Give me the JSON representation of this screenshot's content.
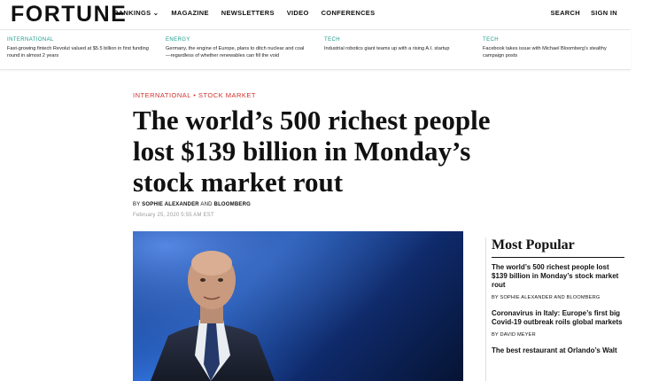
{
  "nav": {
    "logo": "FORTUNE",
    "items": [
      "RANKINGS ⌄",
      "MAGAZINE",
      "NEWSLETTERS",
      "VIDEO",
      "CONFERENCES"
    ],
    "search": "SEARCH",
    "signin": "SIGN IN"
  },
  "ticker": [
    {
      "category": "INTERNATIONAL",
      "text": "Fast-growing fintech Revolut valued at $5.5 billion in first funding round in almost 2 years"
    },
    {
      "category": "ENERGY",
      "text": "Germany, the engine of Europe, plans to ditch nuclear and coal—regardless of whether renewables can fill the void"
    },
    {
      "category": "TECH",
      "text": "Industrial robotics giant teams up with a rising A.I. startup"
    },
    {
      "category": "TECH",
      "text": "Facebook takes issue with Michael Bloomberg's stealthy campaign posts"
    }
  ],
  "article": {
    "kicker": "INTERNATIONAL • STOCK MARKET",
    "headline": "The world’s 500 richest people lost $139 billion in Monday’s stock market rout",
    "by_prefix": "BY",
    "author1": "SOPHIE ALEXANDER",
    "and": "AND",
    "author2": "BLOOMBERG",
    "date": "February 25, 2020 5:55 AM EST"
  },
  "most_popular": {
    "title": "Most Popular",
    "items": [
      {
        "title": "The world’s 500 richest people lost $139 billion in Monday’s stock market rout",
        "byline": "BY SOPHIE ALEXANDER AND BLOOMBERG"
      },
      {
        "title": "Coronavirus in Italy: Europe’s first big Covid-19 outbreak roils global markets",
        "byline": "BY DAVID MEYER"
      },
      {
        "title": "The best restaurant at Orlando’s Walt",
        "byline": ""
      }
    ]
  }
}
